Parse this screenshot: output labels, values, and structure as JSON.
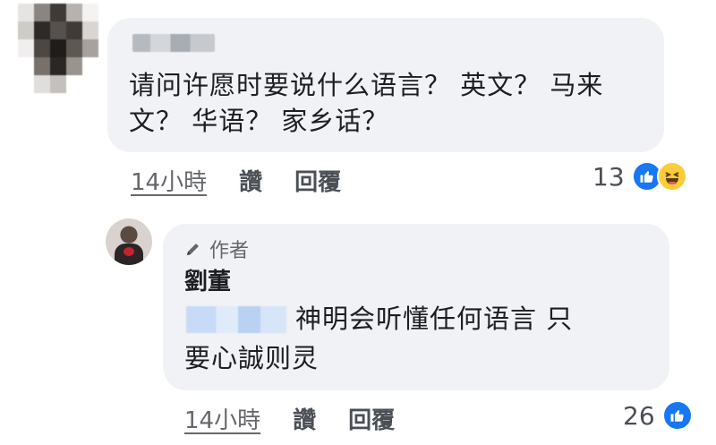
{
  "comment1": {
    "text": "请问许愿时要说什么语言？ 英文？ 马来文？ 华语？ 家乡话？",
    "time": "14小時",
    "like_label": "讚",
    "reply_label": "回覆",
    "reaction_count": "13",
    "reactions": [
      "like-icon",
      "haha-icon"
    ]
  },
  "comment2": {
    "badge": "作者",
    "author": "劉董",
    "text_line1": "神明会听懂任何语言 只",
    "text_line2": "要心誠则灵",
    "time": "14小時",
    "like_label": "讚",
    "reply_label": "回覆",
    "reaction_count": "26",
    "reactions": [
      "like-icon"
    ]
  },
  "colors": {
    "bubble": "#f0f2f5",
    "like": "#1877f2",
    "haha": "#fbcd3a",
    "meta_text": "#65676b"
  }
}
